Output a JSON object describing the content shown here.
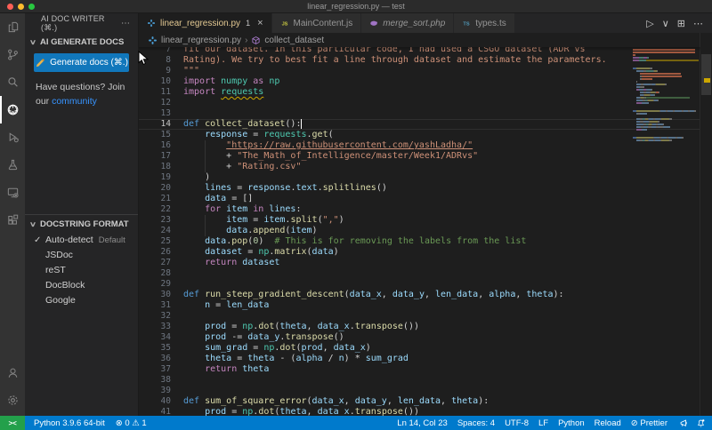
{
  "window": {
    "title": "linear_regression.py — test"
  },
  "colors": {
    "accent_blue": "#007acc",
    "remote_green": "#23a04b",
    "button_blue": "#1177bb",
    "link_blue": "#3794ff",
    "warning": "#cca700",
    "active_tab_label": "#e2c892"
  },
  "activity_bar": {
    "items": [
      {
        "name": "explorer",
        "icon": "files-icon",
        "active": false
      },
      {
        "name": "source-control",
        "icon": "source-control-icon",
        "active": false
      },
      {
        "name": "search",
        "icon": "search-icon",
        "active": false
      },
      {
        "name": "ai-doc-writer",
        "icon": "wireframe-sphere-icon",
        "active": true
      },
      {
        "name": "run-debug",
        "icon": "run-debug-icon",
        "active": false
      },
      {
        "name": "testing",
        "icon": "beaker-icon",
        "active": false
      },
      {
        "name": "remote-explorer",
        "icon": "remote-monitor-icon",
        "active": false
      },
      {
        "name": "extensions",
        "icon": "extensions-icon",
        "active": false
      }
    ],
    "bottom_items": [
      {
        "name": "accounts",
        "icon": "account-icon"
      },
      {
        "name": "settings",
        "icon": "gear-icon"
      }
    ]
  },
  "sidebar": {
    "title": "AI DOC WRITER (⌘.)",
    "more_label": "⋯",
    "chevron": "∨",
    "sections": [
      {
        "label": "AI GENERATE DOCS"
      },
      {
        "label": "DOCSTRING FORMAT"
      }
    ],
    "generate_button": {
      "label": "Generate docs (⌘.)",
      "icon": "pencil-icon"
    },
    "help_line1": "Have questions? Join",
    "help_line2_prefix": "our ",
    "help_link": "community",
    "format_options": [
      {
        "label": "Auto-detect",
        "badge": "Default",
        "selected": true
      },
      {
        "label": "JSDoc",
        "selected": false
      },
      {
        "label": "reST",
        "selected": false
      },
      {
        "label": "DocBlock",
        "selected": false
      },
      {
        "label": "Google",
        "selected": false
      }
    ]
  },
  "tabs": [
    {
      "label": "linear_regression.py",
      "icon": "python-icon",
      "badge": "1",
      "close": "×",
      "active": true,
      "preview": false
    },
    {
      "label": "MainContent.js",
      "icon": "js-icon",
      "active": false,
      "preview": false
    },
    {
      "label": "merge_sort.php",
      "icon": "php-icon",
      "active": false,
      "preview": true
    },
    {
      "label": "types.ts",
      "icon": "ts-icon",
      "active": false,
      "preview": false
    }
  ],
  "editor_actions": [
    {
      "name": "run-button",
      "glyph": "▷"
    },
    {
      "name": "run-dropdown-icon",
      "glyph": "∨"
    },
    {
      "name": "split-editor-button",
      "glyph": "⊞"
    },
    {
      "name": "more-actions-button",
      "glyph": "⋯"
    }
  ],
  "breadcrumb": {
    "file": "linear_regression.py",
    "separator": "›",
    "symbol": "collect_dataset"
  },
  "editor": {
    "lines": [
      {
        "n": 7,
        "segs": [
          [
            "str",
            "fit our dataset. In this particular code, I had used a CSGO dataset (ADR vs"
          ]
        ]
      },
      {
        "n": 8,
        "segs": [
          [
            "str",
            "Rating). We try to best fit a line through dataset and estimate the parameters."
          ]
        ]
      },
      {
        "n": 9,
        "segs": [
          [
            "str",
            "\"\"\""
          ]
        ]
      },
      {
        "n": 10,
        "segs": [
          [
            "ctrl",
            "import "
          ],
          [
            "type",
            "numpy"
          ],
          [
            "ctrl",
            " as "
          ],
          [
            "type",
            "np"
          ]
        ]
      },
      {
        "n": 11,
        "warn": true,
        "segs": [
          [
            "ctrl",
            "import "
          ],
          [
            "type sq",
            "requests"
          ]
        ]
      },
      {
        "n": 12,
        "segs": []
      },
      {
        "n": 13,
        "segs": []
      },
      {
        "n": 14,
        "cur": true,
        "segs": [
          [
            "kw",
            "def "
          ],
          [
            "fn",
            "collect_dataset"
          ],
          [
            "pun",
            "():"
          ],
          [
            "cursor",
            ""
          ]
        ]
      },
      {
        "n": 15,
        "segs": [
          [
            "pun",
            "    "
          ],
          [
            "var",
            "response"
          ],
          [
            "pun",
            " = "
          ],
          [
            "type",
            "requests"
          ],
          [
            "pun",
            "."
          ],
          [
            "fn",
            "get"
          ],
          [
            "pun",
            "("
          ]
        ]
      },
      {
        "n": 16,
        "segs": [
          [
            "pun",
            "        "
          ],
          [
            "str ul",
            "\"https://raw.githubusercontent.com/yashLadha/\""
          ]
        ]
      },
      {
        "n": 17,
        "segs": [
          [
            "pun",
            "        + "
          ],
          [
            "str",
            "\"The_Math_of_Intelligence/master/Week1/ADRvs\""
          ]
        ]
      },
      {
        "n": 18,
        "segs": [
          [
            "pun",
            "        + "
          ],
          [
            "str",
            "\"Rating.csv\""
          ]
        ]
      },
      {
        "n": 19,
        "segs": [
          [
            "pun",
            "    )"
          ]
        ]
      },
      {
        "n": 20,
        "segs": [
          [
            "pun",
            "    "
          ],
          [
            "var",
            "lines"
          ],
          [
            "pun",
            " = "
          ],
          [
            "var",
            "response"
          ],
          [
            "pun",
            "."
          ],
          [
            "var",
            "text"
          ],
          [
            "pun",
            "."
          ],
          [
            "fn",
            "splitlines"
          ],
          [
            "pun",
            "()"
          ]
        ]
      },
      {
        "n": 21,
        "segs": [
          [
            "pun",
            "    "
          ],
          [
            "var",
            "data"
          ],
          [
            "pun",
            " = []"
          ]
        ]
      },
      {
        "n": 22,
        "segs": [
          [
            "pun",
            "    "
          ],
          [
            "ctrl",
            "for"
          ],
          [
            "var",
            " item"
          ],
          [
            "ctrl",
            " in"
          ],
          [
            "var",
            " lines"
          ],
          [
            "pun",
            ":"
          ]
        ]
      },
      {
        "n": 23,
        "segs": [
          [
            "pun",
            "        "
          ],
          [
            "var",
            "item"
          ],
          [
            "pun",
            " = "
          ],
          [
            "var",
            "item"
          ],
          [
            "pun",
            "."
          ],
          [
            "fn",
            "split"
          ],
          [
            "pun",
            "("
          ],
          [
            "str",
            "\",\""
          ],
          [
            "pun",
            ")"
          ]
        ]
      },
      {
        "n": 24,
        "segs": [
          [
            "pun",
            "        "
          ],
          [
            "var",
            "data"
          ],
          [
            "pun",
            "."
          ],
          [
            "fn",
            "append"
          ],
          [
            "pun",
            "("
          ],
          [
            "var",
            "item"
          ],
          [
            "pun",
            ")"
          ]
        ]
      },
      {
        "n": 25,
        "segs": [
          [
            "pun",
            "    "
          ],
          [
            "var",
            "data"
          ],
          [
            "pun",
            "."
          ],
          [
            "fn",
            "pop"
          ],
          [
            "pun",
            "("
          ],
          [
            "num",
            "0"
          ],
          [
            "pun",
            ")"
          ],
          [
            "com",
            "  # This is for removing the labels from the list"
          ]
        ]
      },
      {
        "n": 26,
        "segs": [
          [
            "pun",
            "    "
          ],
          [
            "var",
            "dataset"
          ],
          [
            "pun",
            " = "
          ],
          [
            "type",
            "np"
          ],
          [
            "pun",
            "."
          ],
          [
            "fn",
            "matrix"
          ],
          [
            "pun",
            "("
          ],
          [
            "var",
            "data"
          ],
          [
            "pun",
            ")"
          ]
        ]
      },
      {
        "n": 27,
        "segs": [
          [
            "pun",
            "    "
          ],
          [
            "ctrl",
            "return"
          ],
          [
            "var",
            " dataset"
          ]
        ]
      },
      {
        "n": 28,
        "segs": []
      },
      {
        "n": 29,
        "segs": []
      },
      {
        "n": 30,
        "segs": [
          [
            "kw",
            "def "
          ],
          [
            "fn",
            "run_steep_gradient_descent"
          ],
          [
            "pun",
            "("
          ],
          [
            "var",
            "data_x"
          ],
          [
            "pun",
            ", "
          ],
          [
            "var",
            "data_y"
          ],
          [
            "pun",
            ", "
          ],
          [
            "var",
            "len_data"
          ],
          [
            "pun",
            ", "
          ],
          [
            "var",
            "alpha"
          ],
          [
            "pun",
            ", "
          ],
          [
            "var",
            "theta"
          ],
          [
            "pun",
            "):"
          ]
        ]
      },
      {
        "n": 31,
        "segs": [
          [
            "pun",
            "    "
          ],
          [
            "var",
            "n"
          ],
          [
            "pun",
            " = "
          ],
          [
            "var",
            "len_data"
          ]
        ]
      },
      {
        "n": 32,
        "segs": []
      },
      {
        "n": 33,
        "segs": [
          [
            "pun",
            "    "
          ],
          [
            "var",
            "prod"
          ],
          [
            "pun",
            " = "
          ],
          [
            "type",
            "np"
          ],
          [
            "pun",
            "."
          ],
          [
            "fn",
            "dot"
          ],
          [
            "pun",
            "("
          ],
          [
            "var",
            "theta"
          ],
          [
            "pun",
            ", "
          ],
          [
            "var",
            "data_x"
          ],
          [
            "pun",
            "."
          ],
          [
            "fn",
            "transpose"
          ],
          [
            "pun",
            "())"
          ]
        ]
      },
      {
        "n": 34,
        "segs": [
          [
            "pun",
            "    "
          ],
          [
            "var",
            "prod"
          ],
          [
            "pun",
            " -= "
          ],
          [
            "var",
            "data_y"
          ],
          [
            "pun",
            "."
          ],
          [
            "fn",
            "transpose"
          ],
          [
            "pun",
            "()"
          ]
        ]
      },
      {
        "n": 35,
        "segs": [
          [
            "pun",
            "    "
          ],
          [
            "var",
            "sum_grad"
          ],
          [
            "pun",
            " = "
          ],
          [
            "type",
            "np"
          ],
          [
            "pun",
            "."
          ],
          [
            "fn",
            "dot"
          ],
          [
            "pun",
            "("
          ],
          [
            "var",
            "prod"
          ],
          [
            "pun",
            ", "
          ],
          [
            "var",
            "data_x"
          ],
          [
            "pun",
            ")"
          ]
        ]
      },
      {
        "n": 36,
        "segs": [
          [
            "pun",
            "    "
          ],
          [
            "var",
            "theta"
          ],
          [
            "pun",
            " = "
          ],
          [
            "var",
            "theta"
          ],
          [
            "pun",
            " - ("
          ],
          [
            "var",
            "alpha"
          ],
          [
            "pun",
            " / "
          ],
          [
            "var",
            "n"
          ],
          [
            "pun",
            ") * "
          ],
          [
            "var",
            "sum_grad"
          ]
        ]
      },
      {
        "n": 37,
        "segs": [
          [
            "pun",
            "    "
          ],
          [
            "ctrl",
            "return"
          ],
          [
            "var",
            " theta"
          ]
        ]
      },
      {
        "n": 38,
        "segs": []
      },
      {
        "n": 39,
        "segs": []
      },
      {
        "n": 40,
        "segs": [
          [
            "kw",
            "def "
          ],
          [
            "fn",
            "sum_of_square_error"
          ],
          [
            "pun",
            "("
          ],
          [
            "var",
            "data_x"
          ],
          [
            "pun",
            ", "
          ],
          [
            "var",
            "data_y"
          ],
          [
            "pun",
            ", "
          ],
          [
            "var",
            "len_data"
          ],
          [
            "pun",
            ", "
          ],
          [
            "var",
            "theta"
          ],
          [
            "pun",
            "):"
          ]
        ]
      },
      {
        "n": 41,
        "segs": [
          [
            "pun",
            "    "
          ],
          [
            "var",
            "prod"
          ],
          [
            "pun",
            " = "
          ],
          [
            "type",
            "np"
          ],
          [
            "pun",
            "."
          ],
          [
            "fn",
            "dot"
          ],
          [
            "pun",
            "("
          ],
          [
            "var",
            "theta"
          ],
          [
            "pun",
            ", "
          ],
          [
            "var",
            "data_x"
          ],
          [
            "pun",
            "."
          ],
          [
            "fn",
            "transpose"
          ],
          [
            "pun",
            "())"
          ]
        ]
      }
    ]
  },
  "status_bar": {
    "remote_indicator": "><",
    "left": [
      {
        "name": "python-interpreter",
        "text": "Python 3.9.6 64-bit"
      },
      {
        "name": "problems",
        "text": "⊗ 0  ⚠ 1"
      }
    ],
    "right": [
      {
        "name": "cursor-position",
        "text": "Ln 14, Col 23"
      },
      {
        "name": "indentation",
        "text": "Spaces: 4"
      },
      {
        "name": "encoding",
        "text": "UTF-8"
      },
      {
        "name": "eol",
        "text": "LF"
      },
      {
        "name": "language-mode",
        "text": "Python"
      },
      {
        "name": "reload",
        "text": "Reload"
      },
      {
        "name": "prettier",
        "text": "⊘ Prettier"
      }
    ]
  }
}
